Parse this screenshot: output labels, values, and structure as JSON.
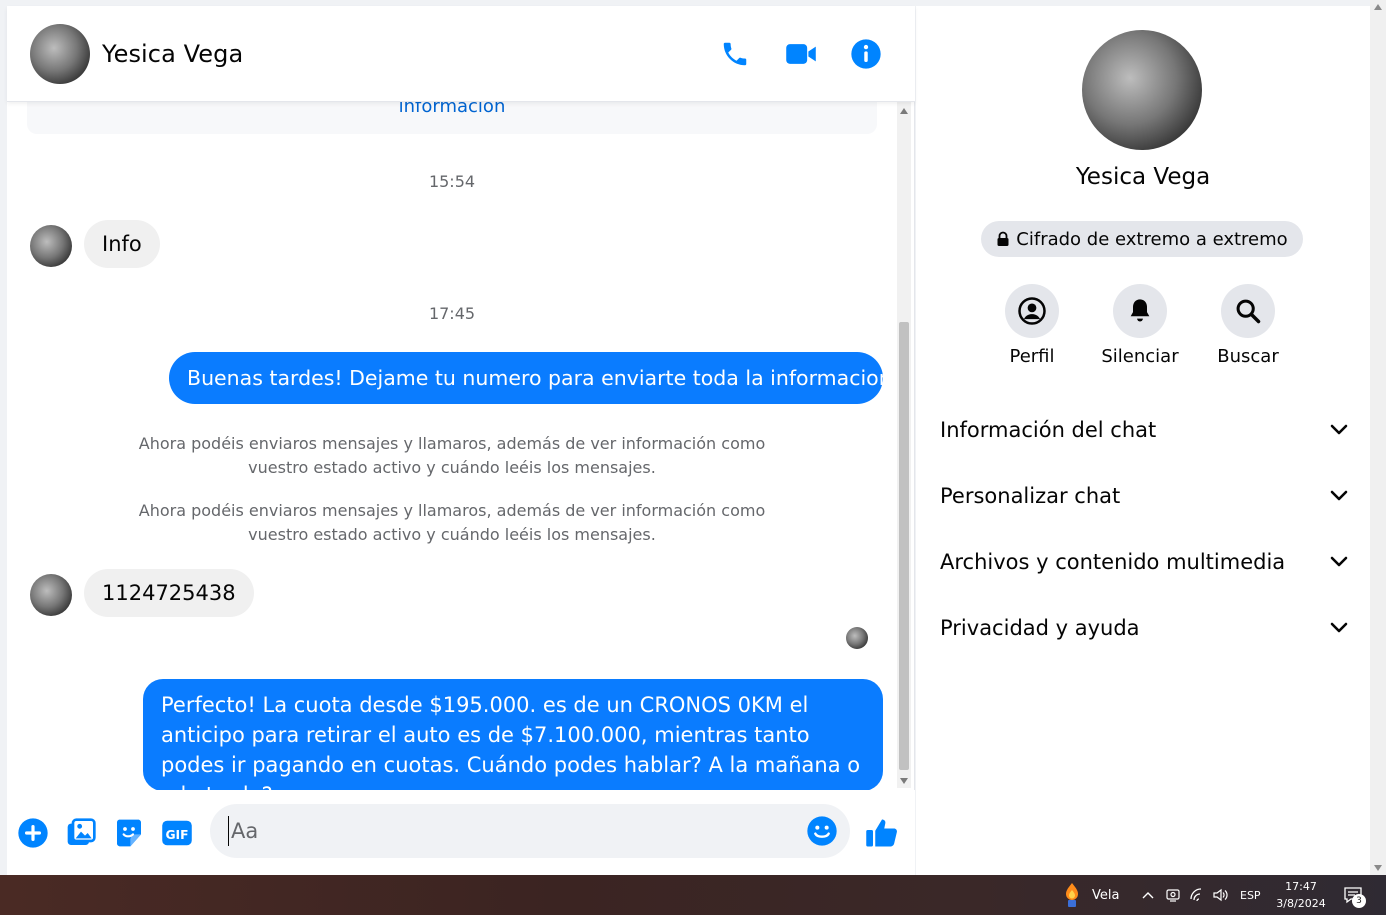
{
  "chat": {
    "contact_name": "Yesica Vega",
    "card_link": "información",
    "timestamps": [
      "15:54",
      "17:45"
    ],
    "messages": {
      "m1": "Info",
      "m2": "Buenas tardes! Dejame tu numero para enviarte toda la informacion.",
      "m3": "1124725438",
      "m4": "Perfecto! La cuota desde $195.000. es de un CRONOS 0KM el anticipo para retirar el auto es de $7.100.000, mientras tanto podes ir pagando en cuotas. Cuándo podes hablar? A la mañana o a la tarde?"
    },
    "system_notes": [
      "Ahora podéis enviaros mensajes y llamaros, además de ver información como vuestro estado activo y cuándo leéis los mensajes.",
      "Ahora podéis enviaros mensajes y llamaros, además de ver información como vuestro estado activo y cuándo leéis los mensajes."
    ],
    "composer_placeholder": "Aa",
    "gif_label": "GIF"
  },
  "info_panel": {
    "name": "Yesica Vega",
    "encryption_badge": "Cifrado de extremo a extremo",
    "actions": [
      {
        "label": "Perfil",
        "icon": "profile-icon"
      },
      {
        "label": "Silenciar",
        "icon": "bell-icon"
      },
      {
        "label": "Buscar",
        "icon": "search-icon"
      }
    ],
    "sections": [
      "Información del chat",
      "Personalizar chat",
      "Archivos y contenido multimedia",
      "Privacidad y ayuda"
    ]
  },
  "taskbar": {
    "weather_label": "Vela",
    "language": "ESP",
    "time": "17:47",
    "date": "3/8/2024",
    "notifications": "3"
  },
  "colors": {
    "accent": "#0a7cff",
    "icon_blue": "#0084ff",
    "incoming_bubble": "#f0f0f0",
    "secondary_text": "#65676b"
  }
}
